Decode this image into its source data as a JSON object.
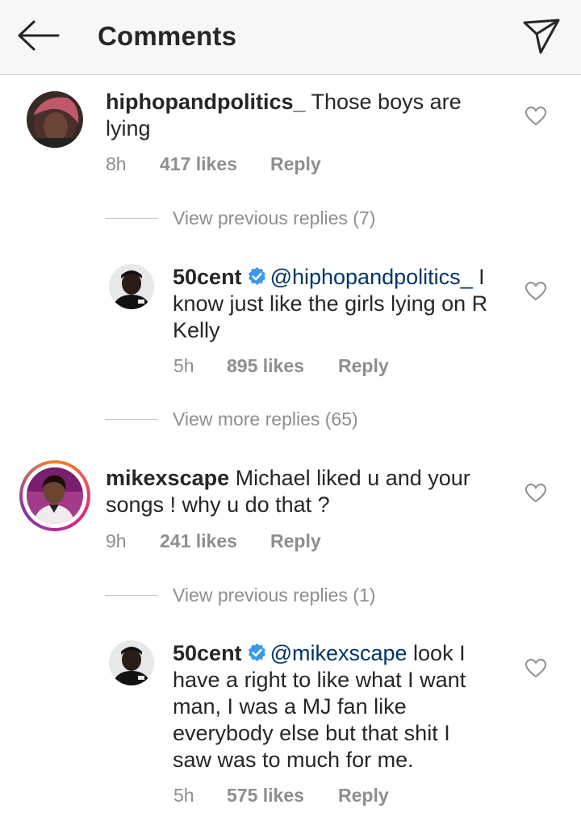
{
  "header": {
    "title": "Comments",
    "back_icon": "arrow-left-icon",
    "send_icon": "paper-plane-icon"
  },
  "comments": [
    {
      "username": "hiphopandpolitics_",
      "text": " Those boys are lying",
      "time": "8h",
      "likes": "417 likes",
      "reply": "Reply",
      "view_replies": "View previous replies (7)"
    },
    {
      "username": "50cent",
      "mention": "@hiphopandpolitics_",
      "text": " I know just like the girls lying on R Kelly",
      "time": "5h",
      "likes": "895 likes",
      "reply": "Reply",
      "view_replies": "View more replies (65)"
    },
    {
      "username": "mikexscape",
      "text": " Michael liked u and your songs ! why u do that ?",
      "time": "9h",
      "likes": "241 likes",
      "reply": "Reply",
      "view_replies": "View previous replies (1)"
    },
    {
      "username": "50cent",
      "mention": "@mikexscape",
      "text": " look I have a right to like what I want man, I was a MJ fan like everybody else but that shit I saw was to much for me.",
      "time": "5h",
      "likes": "575 likes",
      "reply": "Reply"
    }
  ],
  "colors": {
    "mention": "#003569",
    "verified": "#3897f0",
    "muted": "#8e8e8e",
    "story_ring": [
      "#f58529",
      "#dd2a7b",
      "#8134af"
    ]
  }
}
